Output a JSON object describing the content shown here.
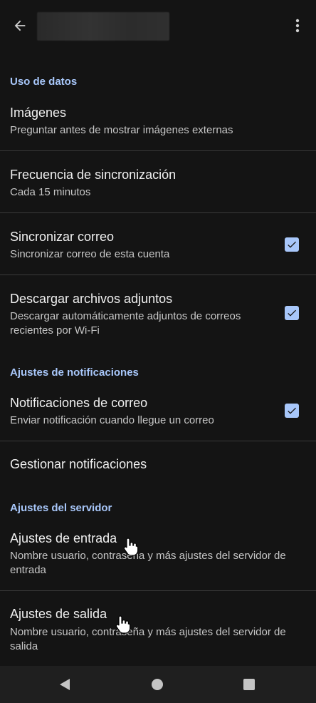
{
  "header": {
    "back_icon": "arrow-left-icon",
    "menu_icon": "more-vert-icon"
  },
  "sections": {
    "data_usage": "Uso de datos",
    "notifications": "Ajustes de notificaciones",
    "server": "Ajustes del servidor"
  },
  "items": {
    "images": {
      "title": "Imágenes",
      "subtitle": "Preguntar antes de mostrar imágenes externas"
    },
    "sync_freq": {
      "title": "Frecuencia de sincronización",
      "subtitle": "Cada 15 minutos"
    },
    "sync_mail": {
      "title": "Sincronizar correo",
      "subtitle": "Sincronizar correo de esta cuenta",
      "checked": true
    },
    "download": {
      "title": "Descargar archivos adjuntos",
      "subtitle_line1": "Descargar automáticamente adjuntos de correos",
      "subtitle_line2": "recientes por Wi-Fi",
      "checked": true
    },
    "mail_notif": {
      "title": "Notificaciones de correo",
      "subtitle": "Enviar notificación cuando llegue un correo",
      "checked": true
    },
    "manage_notif": {
      "title": "Gestionar notificaciones"
    },
    "incoming": {
      "title": "Ajustes de entrada",
      "subtitle_line1": "Nombre usuario, contraseña y más ajustes del servidor de",
      "subtitle_line2": "entrada"
    },
    "outgoing": {
      "title": "Ajustes de salida",
      "subtitle_line1": "Nombre usuario, contraseña y más ajustes del servidor de",
      "subtitle_line2": "salida"
    }
  },
  "colors": {
    "background": "#141414",
    "accent": "#a8c7fa",
    "divider": "#3a3a3a",
    "navbar": "#1f1f1f"
  },
  "navbar": {
    "back_icon": "nav-back-triangle-icon",
    "home_icon": "nav-home-circle-icon",
    "recents_icon": "nav-recents-square-icon"
  }
}
